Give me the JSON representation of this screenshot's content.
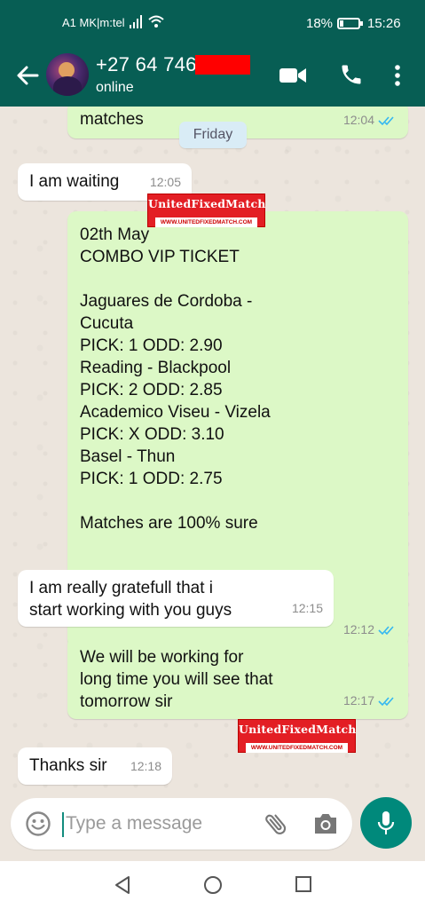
{
  "status_bar": {
    "carrier": "A1 MK|m:tel",
    "battery_text": "18%",
    "battery_level": 0.18,
    "time": "15:26",
    "icons": [
      "signal-icon",
      "wifi-icon",
      "battery-icon"
    ]
  },
  "header": {
    "contact_name": "+27 64 746",
    "status": "online",
    "icons": [
      "back-arrow-icon",
      "video-call-icon",
      "phone-call-icon",
      "more-options-icon"
    ]
  },
  "chat": {
    "date_chip": "Friday",
    "messages": [
      {
        "direction": "outgoing",
        "text": "matches",
        "time": "12:04",
        "read": true
      },
      {
        "direction": "incoming",
        "text": "I am waiting",
        "time": "12:05"
      },
      {
        "direction": "outgoing",
        "text": "02th May\nCOMBO VIP TICKET\n\nJaguares de Cordoba -\nCucuta\nPICK: 1 ODD: 2.90\nReading - Blackpool\nPICK: 2 ODD: 2.85\nAcademico Viseu - Vizela\nPICK: X ODD: 3.10\nBasel - Thun\nPICK: 1 ODD: 2.75\n\nMatches are 100% sure",
        "time": "12:12",
        "read": true
      },
      {
        "direction": "incoming",
        "text": "I am really gratefull that i\nstart working with you guys",
        "time": "12:15"
      },
      {
        "direction": "outgoing",
        "text": "We will be working for\nlong time you will see that\ntomorrow sir",
        "time": "12:17",
        "read": true
      },
      {
        "direction": "incoming",
        "text": "Thanks sir",
        "time": "12:18"
      }
    ],
    "watermark": {
      "title": "UnitedFixedMatch",
      "url": "WWW.UNITEDFIXEDMATCH.COM"
    }
  },
  "composer": {
    "placeholder": "Type a message",
    "icons": [
      "emoji-icon",
      "attach-icon",
      "camera-icon",
      "mic-icon"
    ]
  },
  "nav_bar": {
    "icons": [
      "nav-back-icon",
      "nav-home-icon",
      "nav-recents-icon"
    ]
  },
  "colors": {
    "header": "#075e54",
    "outgoing_bubble": "#dcf8c6",
    "incoming_bubble": "#ffffff",
    "read_ticks": "#34b7f1",
    "mic_button": "#00897b",
    "watermark": "#e31e24"
  }
}
